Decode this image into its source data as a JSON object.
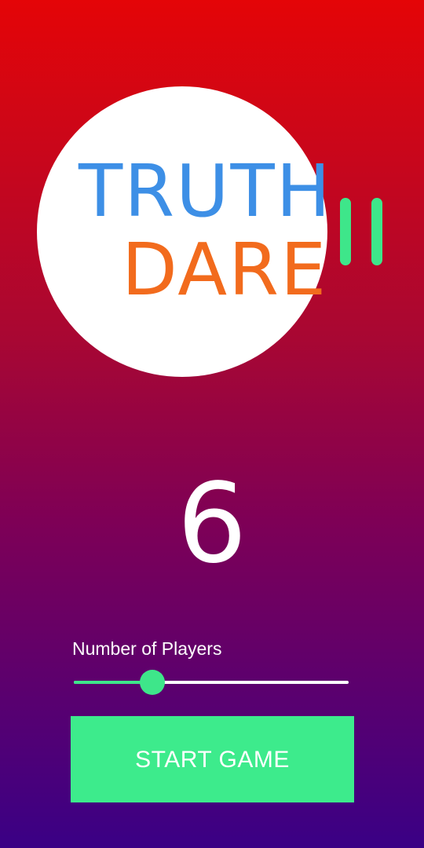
{
  "logo": {
    "line1": "TRUTH",
    "line2": "DARE",
    "colors": {
      "truth": "#3d8fe6",
      "dare": "#f26b1d",
      "mark": "#3ee68a"
    }
  },
  "player_count": {
    "value": "6"
  },
  "players_slider": {
    "label": "Number of Players",
    "value": 6,
    "min": 2,
    "max": 12,
    "fill_color": "#3ee68a",
    "track_color": "#ffffff"
  },
  "actions": {
    "start_label": "START GAME",
    "start_color": "#3deb8c"
  },
  "background": {
    "gradient_top": "#e40507",
    "gradient_bottom": "#3a0085"
  }
}
